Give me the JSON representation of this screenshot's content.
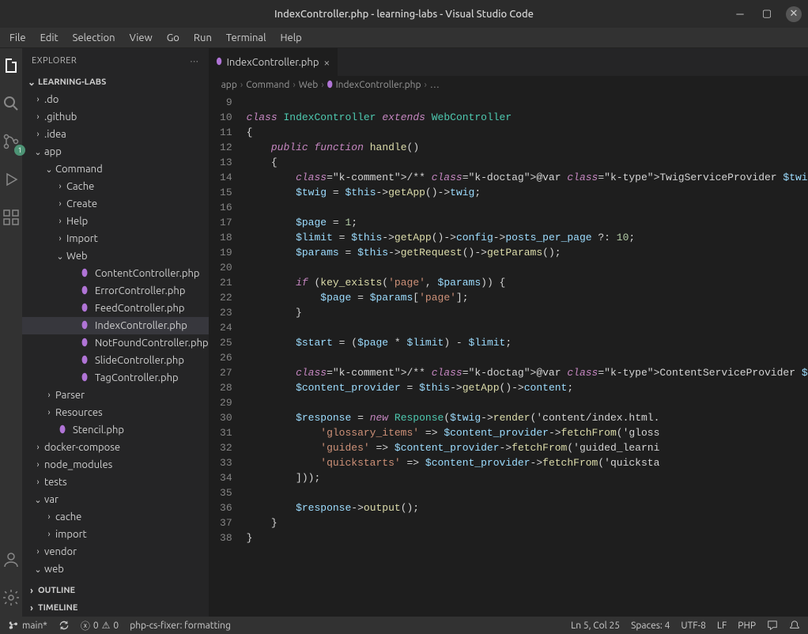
{
  "window": {
    "title": "IndexController.php - learning-labs - Visual Studio Code"
  },
  "menubar": [
    "File",
    "Edit",
    "Selection",
    "View",
    "Go",
    "Run",
    "Terminal",
    "Help"
  ],
  "activitybar": {
    "items": [
      {
        "name": "explorer-icon",
        "active": true
      },
      {
        "name": "search-icon",
        "active": false
      },
      {
        "name": "source-control-icon",
        "active": false,
        "badge": "1"
      },
      {
        "name": "debug-icon",
        "active": false
      },
      {
        "name": "extensions-icon",
        "active": false
      }
    ],
    "bottom": [
      {
        "name": "account-icon"
      },
      {
        "name": "settings-gear-icon"
      }
    ]
  },
  "sidebar": {
    "title": "EXPLORER",
    "workspace": "LEARNING-LABS",
    "tree": [
      {
        "depth": 0,
        "exp": false,
        "type": "folder",
        "name": ".do"
      },
      {
        "depth": 0,
        "exp": false,
        "type": "folder",
        "name": ".github"
      },
      {
        "depth": 0,
        "exp": false,
        "type": "folder",
        "name": ".idea"
      },
      {
        "depth": 0,
        "exp": true,
        "type": "folder",
        "name": "app"
      },
      {
        "depth": 1,
        "exp": true,
        "type": "folder",
        "name": "Command"
      },
      {
        "depth": 2,
        "exp": false,
        "type": "folder",
        "name": "Cache"
      },
      {
        "depth": 2,
        "exp": false,
        "type": "folder",
        "name": "Create"
      },
      {
        "depth": 2,
        "exp": false,
        "type": "folder",
        "name": "Help"
      },
      {
        "depth": 2,
        "exp": false,
        "type": "folder",
        "name": "Import"
      },
      {
        "depth": 2,
        "exp": true,
        "type": "folder",
        "name": "Web"
      },
      {
        "depth": 3,
        "exp": null,
        "type": "php",
        "name": "ContentController.php"
      },
      {
        "depth": 3,
        "exp": null,
        "type": "php",
        "name": "ErrorController.php"
      },
      {
        "depth": 3,
        "exp": null,
        "type": "php",
        "name": "FeedController.php"
      },
      {
        "depth": 3,
        "exp": null,
        "type": "php",
        "name": "IndexController.php",
        "selected": true
      },
      {
        "depth": 3,
        "exp": null,
        "type": "php",
        "name": "NotFoundController.php"
      },
      {
        "depth": 3,
        "exp": null,
        "type": "php",
        "name": "SlideController.php"
      },
      {
        "depth": 3,
        "exp": null,
        "type": "php",
        "name": "TagController.php"
      },
      {
        "depth": 1,
        "exp": false,
        "type": "folder",
        "name": "Parser"
      },
      {
        "depth": 1,
        "exp": false,
        "type": "folder",
        "name": "Resources"
      },
      {
        "depth": 1,
        "exp": null,
        "type": "php",
        "name": "Stencil.php"
      },
      {
        "depth": 0,
        "exp": false,
        "type": "folder",
        "name": "docker-compose"
      },
      {
        "depth": 0,
        "exp": false,
        "type": "folder",
        "name": "node_modules"
      },
      {
        "depth": 0,
        "exp": false,
        "type": "folder",
        "name": "tests"
      },
      {
        "depth": 0,
        "exp": true,
        "type": "folder",
        "name": "var"
      },
      {
        "depth": 1,
        "exp": false,
        "type": "folder",
        "name": "cache"
      },
      {
        "depth": 1,
        "exp": false,
        "type": "folder",
        "name": "import"
      },
      {
        "depth": 0,
        "exp": false,
        "type": "folder",
        "name": "vendor"
      },
      {
        "depth": 0,
        "exp": true,
        "type": "folder",
        "name": "web"
      }
    ],
    "outline": "OUTLINE",
    "timeline": "TIMELINE"
  },
  "editor": {
    "tab": {
      "label": "IndexController.php",
      "icon": "php"
    },
    "breadcrumbs": [
      "app",
      "Command",
      "Web",
      "IndexController.php",
      "…"
    ],
    "first_line": 9,
    "lines": [
      "",
      "class IndexController extends WebController",
      "{",
      "    public function handle()",
      "    {",
      "        /** @var TwigServiceProvider $twig */",
      "        $twig = $this->getApp()->twig;",
      "",
      "        $page = 1;",
      "        $limit = $this->getApp()->config->posts_per_page ?: 10;",
      "        $params = $this->getRequest()->getParams();",
      "",
      "        if (key_exists('page', $params)) {",
      "            $page = $params['page'];",
      "        }",
      "",
      "        $start = ($page * $limit) - $limit;",
      "",
      "        /** @var ContentServiceProvider $content_provider */",
      "        $content_provider = $this->getApp()->content;",
      "",
      "        $response = new Response($twig->render('content/index.html.",
      "            'glossary_items' => $content_provider->fetchFrom('gloss",
      "            'guides' => $content_provider->fetchFrom('guided_learni",
      "            'quickstarts' => $content_provider->fetchFrom('quicksta",
      "        ]));",
      "",
      "        $response->output();",
      "    }",
      "}"
    ]
  },
  "statusbar": {
    "branch": "main*",
    "errors": "0",
    "warnings": "0",
    "formatter": "php-cs-fixer: formatting",
    "lncol": "Ln 5, Col 25",
    "spaces": "Spaces: 4",
    "encoding": "UTF-8",
    "eol": "LF",
    "lang": "PHP"
  }
}
